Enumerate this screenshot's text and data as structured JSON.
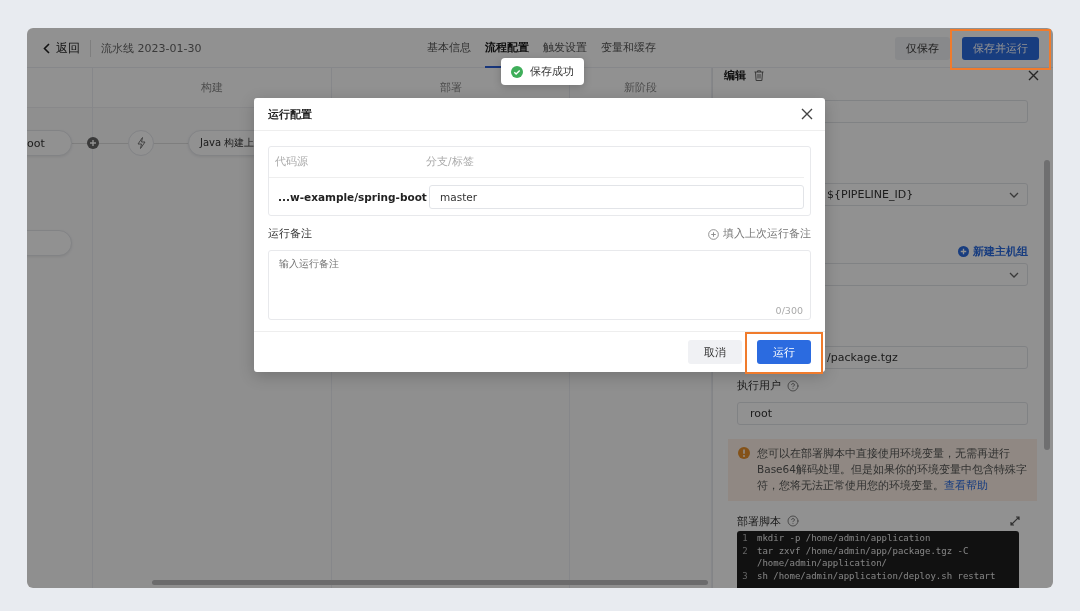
{
  "header": {
    "back": "返回",
    "title": "流水线 2023-01-30",
    "tabs": [
      {
        "label": "基本信息",
        "selected": false
      },
      {
        "label": "流程配置",
        "selected": true
      },
      {
        "label": "触发设置",
        "selected": false
      },
      {
        "label": "变量和缓存",
        "selected": false
      }
    ],
    "buttons": [
      {
        "label": "仅保存",
        "kind": "secondary"
      },
      {
        "label": "保存并运行",
        "kind": "primary",
        "highlighted": true
      }
    ]
  },
  "stages": [
    {
      "label": "构建"
    },
    {
      "label": "部署"
    },
    {
      "label": "新阶段"
    }
  ],
  "nodes": [
    {
      "label": "oot"
    },
    {
      "label": "Java 构建上"
    }
  ],
  "panel": {
    "title": "编辑",
    "fields": [
      {
        "kind": "input"
      },
      {
        "kind": "select",
        "value": "${PIPELINE_ID}"
      },
      {
        "kind": "select",
        "action": "新建主机组"
      },
      {
        "kind": "input",
        "value": "/package.tgz"
      },
      {
        "kind": "input",
        "label": "执行用户",
        "value": "root"
      }
    ],
    "alert": {
      "text": "您可以在部署脚本中直接使用环境变量，无需再进行Base64解码处理。但是如果你的环境变量中包含特殊字符，您将无法正常使用您的环境变量。",
      "link": "查看帮助"
    },
    "script": {
      "label": "部署脚本",
      "lines": [
        {
          "number": "1",
          "code": "mkdir -p /home/admin/application"
        },
        {
          "number": "2",
          "code": "tar zxvf /home/admin/app/package.tgz -C /home/admin/application/"
        },
        {
          "number": "3",
          "code": "sh /home/admin/application/deploy.sh restart"
        }
      ]
    }
  },
  "toast": {
    "text": "保存成功"
  },
  "dialog": {
    "title": "运行配置",
    "columns": [
      "代码源",
      "分支/标签"
    ],
    "row": {
      "source": "...w-example/spring-boot",
      "branch": "master"
    },
    "note_label": "运行备注",
    "note_action": "填入上次运行备注",
    "note_placeholder": "输入运行备注",
    "counter": "0/300",
    "buttons": [
      {
        "label": "取消",
        "kind": "secondary"
      },
      {
        "label": "运行",
        "kind": "primary",
        "highlighted": true
      }
    ]
  }
}
